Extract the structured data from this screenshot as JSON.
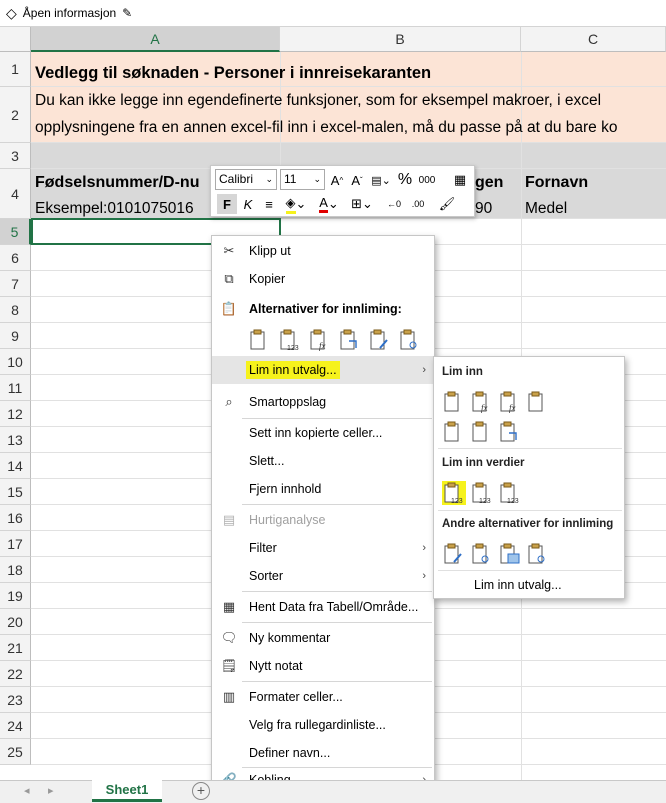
{
  "topbar": {
    "label": "Åpen informasjon"
  },
  "columns": [
    {
      "name": "A"
    },
    {
      "name": "B"
    },
    {
      "name": "C"
    }
  ],
  "rows": [
    "1",
    "2",
    "3",
    "4",
    "5",
    "6",
    "7",
    "8",
    "9",
    "10",
    "11",
    "12",
    "13",
    "14",
    "15",
    "16",
    "17",
    "18",
    "19",
    "20",
    "21",
    "22",
    "23",
    "24",
    "25"
  ],
  "cells": {
    "r1": "Vedlegg til søknaden - Personer i innreisekaranten",
    "r2a": "Du kan ikke legge inn egendefinerte funksjoner, som for eksempel makroer, i excel",
    "r2b": "opplysningene fra en annen excel-fil inn i excel-malen, må du passe på at du bare ko",
    "h_a": "Fødselsnummer/D-nu",
    "h_b": "gen",
    "h_c": "Fornavn",
    "e_a": "Eksempel:0101075016",
    "e_b": "90",
    "e_c": "Medel"
  },
  "colors": {
    "title_bg": "#fce4d6",
    "header_bg": "#d9d9d9",
    "highlight": "#f6f21c",
    "accent": "#217346"
  },
  "minibar": {
    "font": "Calibri",
    "size": "11",
    "bold": "F",
    "italic": "K"
  },
  "context_menu": {
    "cut": "Klipp ut",
    "copy": "Kopier",
    "paste_options": "Alternativer for innliming:",
    "paste_special": "Lim inn utvalg...",
    "smart_lookup": "Smartoppslag",
    "insert_copied": "Sett inn kopierte celler...",
    "delete": "Slett...",
    "clear": "Fjern innhold",
    "quick_analysis": "Hurtiganalyse",
    "filter": "Filter",
    "sort": "Sorter",
    "get_data": "Hent Data fra Tabell/Område...",
    "new_comment": "Ny kommentar",
    "new_note": "Nytt notat",
    "format_cells": "Formater celler...",
    "pick_list": "Velg fra rullegardinliste...",
    "define_name": "Definer navn...",
    "link": "Kobling"
  },
  "submenu": {
    "paste": "Lim inn",
    "paste_values": "Lim inn verdier",
    "other_options": "Andre alternativer for innliming",
    "paste_special": "Lim inn utvalg..."
  },
  "sheet": {
    "tab": "Sheet1"
  }
}
